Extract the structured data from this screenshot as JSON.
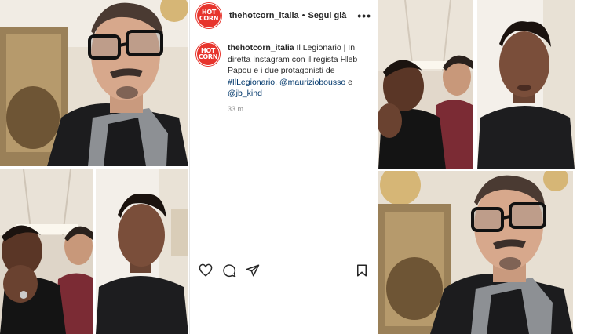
{
  "post": {
    "username": "thehotcorn_italia",
    "separator": "•",
    "follow_status": "Segui già",
    "more_icon": "more-horizontal-icon",
    "avatar_text": "HOT CORN",
    "caption": {
      "username": "thehotcorn_italia",
      "part1": " Il Legionario | In diretta Instagram con il regista Hleb Papou e i due protagonisti de ",
      "hashtag": "#IlLegionario",
      "sep1": ", ",
      "mention1": "@mauriziobousso",
      "sep2": " e ",
      "mention2": "@jb_kind"
    },
    "timestamp": "33 m",
    "actions": [
      "like-icon",
      "comment-icon",
      "share-icon",
      "save-icon"
    ]
  },
  "colors": {
    "brand_red": "#e7352d",
    "link_blue": "#00376b"
  }
}
